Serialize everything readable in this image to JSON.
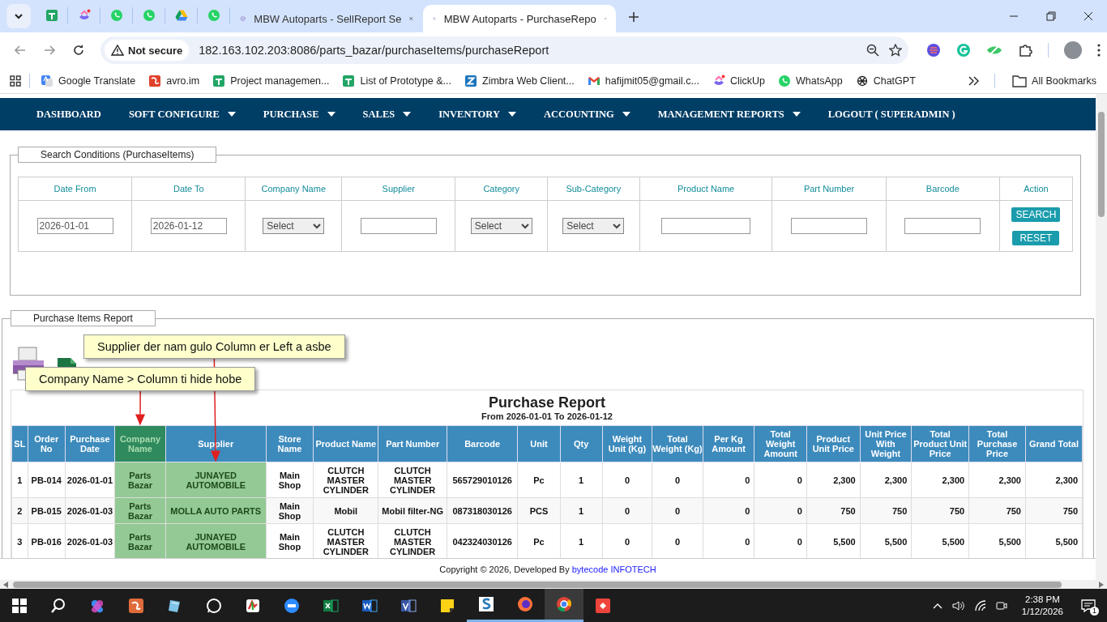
{
  "browser": {
    "tabs": [
      {
        "title": "MBW Autoparts - SellReport Se",
        "selected": false
      },
      {
        "title": "MBW Autoparts - PurchaseRepo",
        "selected": true
      }
    ],
    "security": "Not secure",
    "url": "182.163.102.203:8086/parts_bazar/purchaseItems/purchaseReport",
    "bookmarks": [
      "Google Translate",
      "avro.im",
      "Project managemen...",
      "List of Prototype &...",
      "Zimbra Web Client...",
      "hafijmit05@gmail.c...",
      "ClickUp",
      "WhatsApp",
      "ChatGPT"
    ],
    "all_bookmarks": "All Bookmarks"
  },
  "nav": [
    {
      "label": "DASHBOARD",
      "dropdown": false
    },
    {
      "label": "SOFT CONFIGURE",
      "dropdown": true
    },
    {
      "label": "PURCHASE",
      "dropdown": true
    },
    {
      "label": "SALES",
      "dropdown": true
    },
    {
      "label": "INVENTORY",
      "dropdown": true
    },
    {
      "label": "ACCOUNTING",
      "dropdown": true
    },
    {
      "label": "MANAGEMENT REPORTS",
      "dropdown": true
    },
    {
      "label": "LOGOUT ( SUPERADMIN )",
      "dropdown": false
    }
  ],
  "search": {
    "legend": "Search Conditions (PurchaseItems)",
    "columns": [
      "Date From",
      "Date To",
      "Company Name",
      "Supplier",
      "Category",
      "Sub-Category",
      "Product Name",
      "Part Number",
      "Barcode",
      "Action"
    ],
    "fields": [
      {
        "kind": "input",
        "value": "2026-01-01"
      },
      {
        "kind": "input",
        "value": "2026-01-12"
      },
      {
        "kind": "select",
        "value": "Select"
      },
      {
        "kind": "input"
      },
      {
        "kind": "select",
        "value": "Select"
      },
      {
        "kind": "select",
        "value": "Select"
      },
      {
        "kind": "input"
      },
      {
        "kind": "input"
      },
      {
        "kind": "input"
      },
      {
        "kind": "actions",
        "buttons": [
          "SEARCH",
          "RESET"
        ]
      }
    ]
  },
  "report": {
    "legend": "Purchase Items Report",
    "title": "Purchase Report",
    "subtitle": "From 2026-01-01 To 2026-01-12",
    "columns": [
      {
        "label": "SL",
        "header_highlighted": false,
        "cells_highlighted": false
      },
      {
        "label": "Order No",
        "header_highlighted": false,
        "cells_highlighted": false
      },
      {
        "label": "Purchase Date",
        "header_highlighted": false,
        "cells_highlighted": false
      },
      {
        "label": "Company Name",
        "header_highlighted": true,
        "cells_highlighted": true,
        "note": "Company Name > Column ti hide hobe"
      },
      {
        "label": "Supplier",
        "header_highlighted": false,
        "cells_highlighted": true,
        "note": "Supplier der nam gulo Column er Left a asbe"
      },
      {
        "label": "Store Name",
        "header_highlighted": false,
        "cells_highlighted": false
      },
      {
        "label": "Product Name",
        "header_highlighted": false,
        "cells_highlighted": false
      },
      {
        "label": "Part Number",
        "header_highlighted": false,
        "cells_highlighted": false
      },
      {
        "label": "Barcode",
        "header_highlighted": false,
        "cells_highlighted": false
      },
      {
        "label": "Unit",
        "header_highlighted": false,
        "cells_highlighted": false
      },
      {
        "label": "Qty",
        "header_highlighted": false,
        "cells_highlighted": false
      },
      {
        "label": "Weight Unit (Kg)",
        "header_highlighted": false,
        "cells_highlighted": false
      },
      {
        "label": "Total Weight (Kg)",
        "header_highlighted": false,
        "cells_highlighted": false
      },
      {
        "label": "Per Kg Amount",
        "header_highlighted": false,
        "cells_highlighted": false
      },
      {
        "label": "Total Weight Amount",
        "header_highlighted": false,
        "cells_highlighted": false
      },
      {
        "label": "Product Unit Price",
        "header_highlighted": false,
        "cells_highlighted": false
      },
      {
        "label": "Unit Price With Weight",
        "header_highlighted": false,
        "cells_highlighted": false
      },
      {
        "label": "Total Product Unit Price",
        "header_highlighted": false,
        "cells_highlighted": false
      },
      {
        "label": "Total Purchase Price",
        "header_highlighted": false,
        "cells_highlighted": false
      },
      {
        "label": "Grand Total",
        "header_highlighted": false,
        "cells_highlighted": false
      }
    ],
    "rows": [
      [
        "1",
        "PB-014",
        "2026-01-01",
        "Parts Bazar",
        "JUNAYED AUTOMOBILE",
        "Main Shop",
        "CLUTCH MASTER CYLINDER",
        "CLUTCH MASTER CYLINDER",
        "565729010126",
        "Pc",
        "1",
        "0",
        "0",
        "0",
        "0",
        "2,300",
        "2,300",
        "2,300",
        "2,300",
        "2,300"
      ],
      [
        "2",
        "PB-015",
        "2026-01-03",
        "Parts Bazar",
        "MOLLA AUTO PARTS",
        "Main Shop",
        "Mobil",
        "Mobil filter-NG",
        "087318030126",
        "PCS",
        "1",
        "0",
        "0",
        "0",
        "0",
        "750",
        "750",
        "750",
        "750",
        "750"
      ],
      [
        "3",
        "PB-016",
        "2026-01-03",
        "Parts Bazar",
        "JUNAYED AUTOMOBILE",
        "Main Shop",
        "CLUTCH MASTER CYLINDER",
        "CLUTCH MASTER CYLINDER",
        "042324030126",
        "Pc",
        "1",
        "0",
        "0",
        "0",
        "0",
        "5,500",
        "5,500",
        "5,500",
        "5,500",
        "5,500"
      ]
    ],
    "copyright": "Copyright © 2026, Developed By ",
    "developer": "bytecode INFOTECH"
  },
  "taskbar": {
    "time": "2:38 PM",
    "date": "1/12/2026",
    "notifications": "1"
  }
}
